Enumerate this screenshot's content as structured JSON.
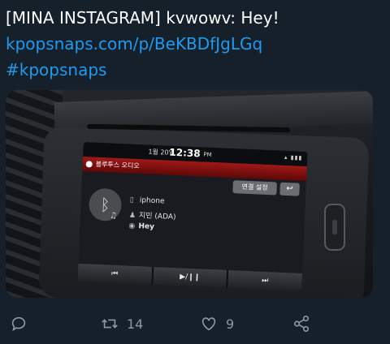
{
  "tweet": {
    "line1": "[MINA INSTAGRAM] kvwowv: Hey!",
    "link": "kpopsnaps.com/p/BeKBDfJgLGq",
    "hashtag": "#kpopsnaps"
  },
  "media": {
    "status_date": "1월 20일",
    "status_time": "12:38",
    "status_ampm": "PM",
    "title": "블루투스 오디오",
    "connect_button": "연결 설정",
    "back_symbol": "↩",
    "bluetooth_symbol": "ᛒ",
    "device_name": "iphone",
    "artist": "지민 (ADA)",
    "track": "Hey",
    "prev_symbol": "⏮",
    "play_pause_symbol": "▶/❙❙",
    "next_symbol": "⏭"
  },
  "actions": {
    "reply_count": "",
    "retweet_count": "14",
    "like_count": "9"
  },
  "colors": {
    "background": "#15202b",
    "link": "#1d9bf0",
    "icon": "#8b98a5"
  }
}
